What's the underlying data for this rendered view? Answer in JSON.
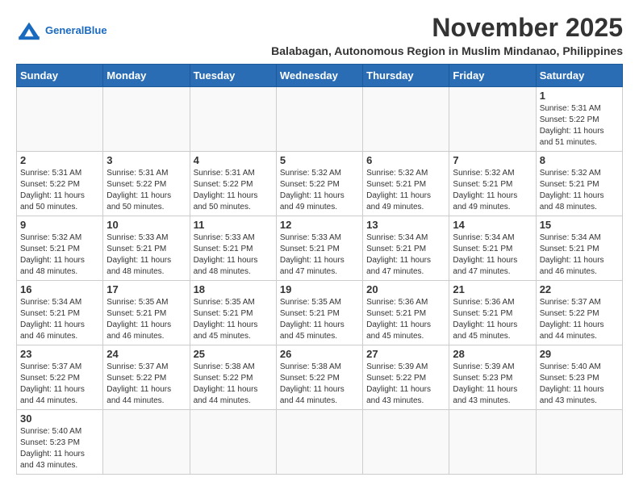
{
  "header": {
    "logo_general": "General",
    "logo_blue": "Blue",
    "month_title": "November 2025",
    "subtitle": "Balabagan, Autonomous Region in Muslim Mindanao, Philippines"
  },
  "days_of_week": [
    "Sunday",
    "Monday",
    "Tuesday",
    "Wednesday",
    "Thursday",
    "Friday",
    "Saturday"
  ],
  "weeks": [
    [
      {
        "day": "",
        "info": ""
      },
      {
        "day": "",
        "info": ""
      },
      {
        "day": "",
        "info": ""
      },
      {
        "day": "",
        "info": ""
      },
      {
        "day": "",
        "info": ""
      },
      {
        "day": "",
        "info": ""
      },
      {
        "day": "1",
        "info": "Sunrise: 5:31 AM\nSunset: 5:22 PM\nDaylight: 11 hours\nand 51 minutes."
      }
    ],
    [
      {
        "day": "2",
        "info": "Sunrise: 5:31 AM\nSunset: 5:22 PM\nDaylight: 11 hours\nand 50 minutes."
      },
      {
        "day": "3",
        "info": "Sunrise: 5:31 AM\nSunset: 5:22 PM\nDaylight: 11 hours\nand 50 minutes."
      },
      {
        "day": "4",
        "info": "Sunrise: 5:31 AM\nSunset: 5:22 PM\nDaylight: 11 hours\nand 50 minutes."
      },
      {
        "day": "5",
        "info": "Sunrise: 5:32 AM\nSunset: 5:22 PM\nDaylight: 11 hours\nand 49 minutes."
      },
      {
        "day": "6",
        "info": "Sunrise: 5:32 AM\nSunset: 5:21 PM\nDaylight: 11 hours\nand 49 minutes."
      },
      {
        "day": "7",
        "info": "Sunrise: 5:32 AM\nSunset: 5:21 PM\nDaylight: 11 hours\nand 49 minutes."
      },
      {
        "day": "8",
        "info": "Sunrise: 5:32 AM\nSunset: 5:21 PM\nDaylight: 11 hours\nand 48 minutes."
      }
    ],
    [
      {
        "day": "9",
        "info": "Sunrise: 5:32 AM\nSunset: 5:21 PM\nDaylight: 11 hours\nand 48 minutes."
      },
      {
        "day": "10",
        "info": "Sunrise: 5:33 AM\nSunset: 5:21 PM\nDaylight: 11 hours\nand 48 minutes."
      },
      {
        "day": "11",
        "info": "Sunrise: 5:33 AM\nSunset: 5:21 PM\nDaylight: 11 hours\nand 48 minutes."
      },
      {
        "day": "12",
        "info": "Sunrise: 5:33 AM\nSunset: 5:21 PM\nDaylight: 11 hours\nand 47 minutes."
      },
      {
        "day": "13",
        "info": "Sunrise: 5:34 AM\nSunset: 5:21 PM\nDaylight: 11 hours\nand 47 minutes."
      },
      {
        "day": "14",
        "info": "Sunrise: 5:34 AM\nSunset: 5:21 PM\nDaylight: 11 hours\nand 47 minutes."
      },
      {
        "day": "15",
        "info": "Sunrise: 5:34 AM\nSunset: 5:21 PM\nDaylight: 11 hours\nand 46 minutes."
      }
    ],
    [
      {
        "day": "16",
        "info": "Sunrise: 5:34 AM\nSunset: 5:21 PM\nDaylight: 11 hours\nand 46 minutes."
      },
      {
        "day": "17",
        "info": "Sunrise: 5:35 AM\nSunset: 5:21 PM\nDaylight: 11 hours\nand 46 minutes."
      },
      {
        "day": "18",
        "info": "Sunrise: 5:35 AM\nSunset: 5:21 PM\nDaylight: 11 hours\nand 45 minutes."
      },
      {
        "day": "19",
        "info": "Sunrise: 5:35 AM\nSunset: 5:21 PM\nDaylight: 11 hours\nand 45 minutes."
      },
      {
        "day": "20",
        "info": "Sunrise: 5:36 AM\nSunset: 5:21 PM\nDaylight: 11 hours\nand 45 minutes."
      },
      {
        "day": "21",
        "info": "Sunrise: 5:36 AM\nSunset: 5:21 PM\nDaylight: 11 hours\nand 45 minutes."
      },
      {
        "day": "22",
        "info": "Sunrise: 5:37 AM\nSunset: 5:22 PM\nDaylight: 11 hours\nand 44 minutes."
      }
    ],
    [
      {
        "day": "23",
        "info": "Sunrise: 5:37 AM\nSunset: 5:22 PM\nDaylight: 11 hours\nand 44 minutes."
      },
      {
        "day": "24",
        "info": "Sunrise: 5:37 AM\nSunset: 5:22 PM\nDaylight: 11 hours\nand 44 minutes."
      },
      {
        "day": "25",
        "info": "Sunrise: 5:38 AM\nSunset: 5:22 PM\nDaylight: 11 hours\nand 44 minutes."
      },
      {
        "day": "26",
        "info": "Sunrise: 5:38 AM\nSunset: 5:22 PM\nDaylight: 11 hours\nand 44 minutes."
      },
      {
        "day": "27",
        "info": "Sunrise: 5:39 AM\nSunset: 5:22 PM\nDaylight: 11 hours\nand 43 minutes."
      },
      {
        "day": "28",
        "info": "Sunrise: 5:39 AM\nSunset: 5:23 PM\nDaylight: 11 hours\nand 43 minutes."
      },
      {
        "day": "29",
        "info": "Sunrise: 5:40 AM\nSunset: 5:23 PM\nDaylight: 11 hours\nand 43 minutes."
      }
    ],
    [
      {
        "day": "30",
        "info": "Sunrise: 5:40 AM\nSunset: 5:23 PM\nDaylight: 11 hours\nand 43 minutes."
      },
      {
        "day": "",
        "info": ""
      },
      {
        "day": "",
        "info": ""
      },
      {
        "day": "",
        "info": ""
      },
      {
        "day": "",
        "info": ""
      },
      {
        "day": "",
        "info": ""
      },
      {
        "day": "",
        "info": ""
      }
    ]
  ]
}
